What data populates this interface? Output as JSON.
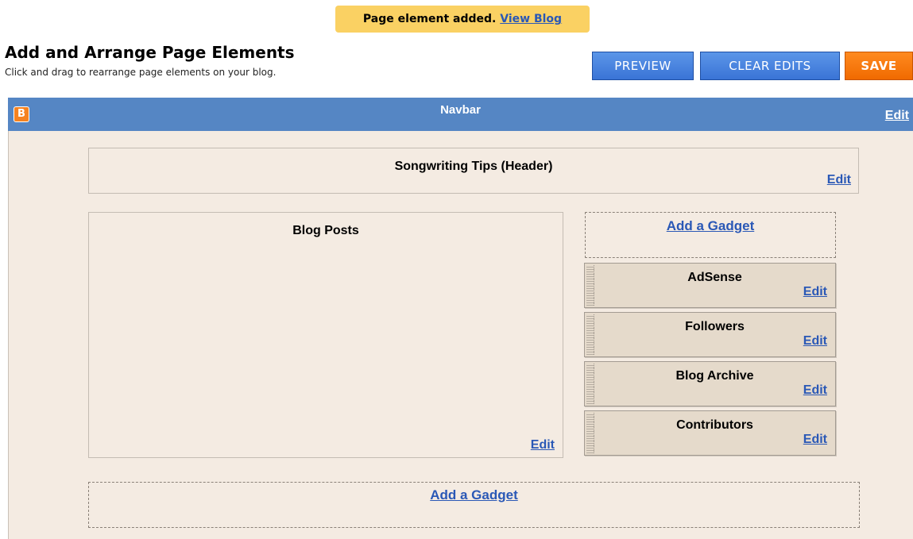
{
  "notice": {
    "message": "Page element added.",
    "link": "View Blog"
  },
  "header": {
    "title": "Add and Arrange Page Elements",
    "subtitle": "Click and drag to rearrange page elements on your blog."
  },
  "toolbar": {
    "preview_label": "PREVIEW",
    "clear_label": "CLEAR EDITS",
    "save_label": "SAVE"
  },
  "navbar": {
    "logo": "B",
    "title": "Navbar",
    "edit": "Edit"
  },
  "blog_header": {
    "title": "Songwriting Tips (Header)",
    "edit": "Edit"
  },
  "posts": {
    "title": "Blog Posts",
    "edit": "Edit"
  },
  "sidebar": {
    "add_gadget": "Add a Gadget",
    "gadgets": [
      {
        "title": "AdSense",
        "edit": "Edit"
      },
      {
        "title": "Followers",
        "edit": "Edit"
      },
      {
        "title": "Blog Archive",
        "edit": "Edit"
      },
      {
        "title": "Contributors",
        "edit": "Edit"
      }
    ]
  },
  "footer": {
    "add_gadget": "Add a Gadget"
  },
  "colors": {
    "navbar": "#5586c4",
    "canvas": "#f4ebe2",
    "notice": "#fad163",
    "save": "#f06a00",
    "button": "#3a74d6"
  }
}
